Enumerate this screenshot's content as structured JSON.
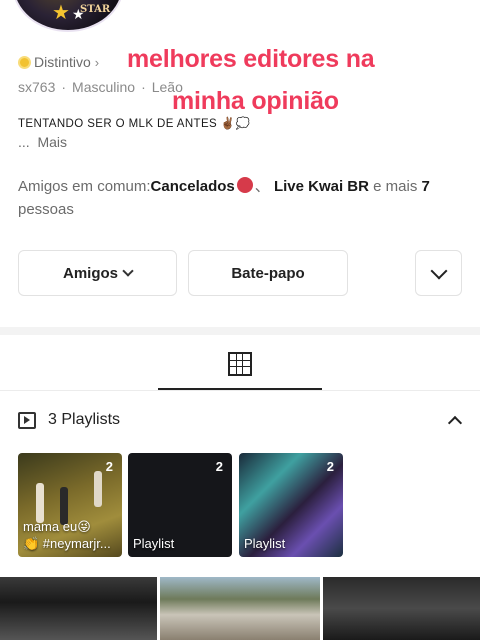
{
  "profile": {
    "badge_label": "Distintivo",
    "username": "sx763",
    "gender": "Masculino",
    "sign": "Leão",
    "bio": "TENTANDO SER O MLK DE ANTES",
    "more_label": "Mais",
    "more_prefix": "...",
    "avatar_logo_text": "STAR"
  },
  "overlay": {
    "line1": "melhores editores na",
    "line2": "minha opinião",
    "color": "#ef3b5c"
  },
  "mutual": {
    "prefix": "Amigos em comum:",
    "friend1": "Cancelados",
    "separator": "、",
    "friend2": "Live Kwai BR",
    "and_more": " e mais ",
    "count": "7",
    "suffix": "pessoas"
  },
  "actions": {
    "friends_label": "Amigos",
    "chat_label": "Bate-papo"
  },
  "playlists": {
    "header": "3 Playlists",
    "items": [
      {
        "count": "2",
        "title_line1": "mama eu😜",
        "title_line2": "👏 #neymarjr..."
      },
      {
        "count": "2",
        "title_line1": "Playlist"
      },
      {
        "count": "2",
        "title_line1": "Playlist"
      }
    ]
  },
  "icons": {
    "badge": "badge-coin-icon",
    "grid": "grid-icon",
    "playlist": "playlist-icon",
    "chevron_up": "chevron-up-icon",
    "chevron_down": "chevron-down-icon"
  }
}
